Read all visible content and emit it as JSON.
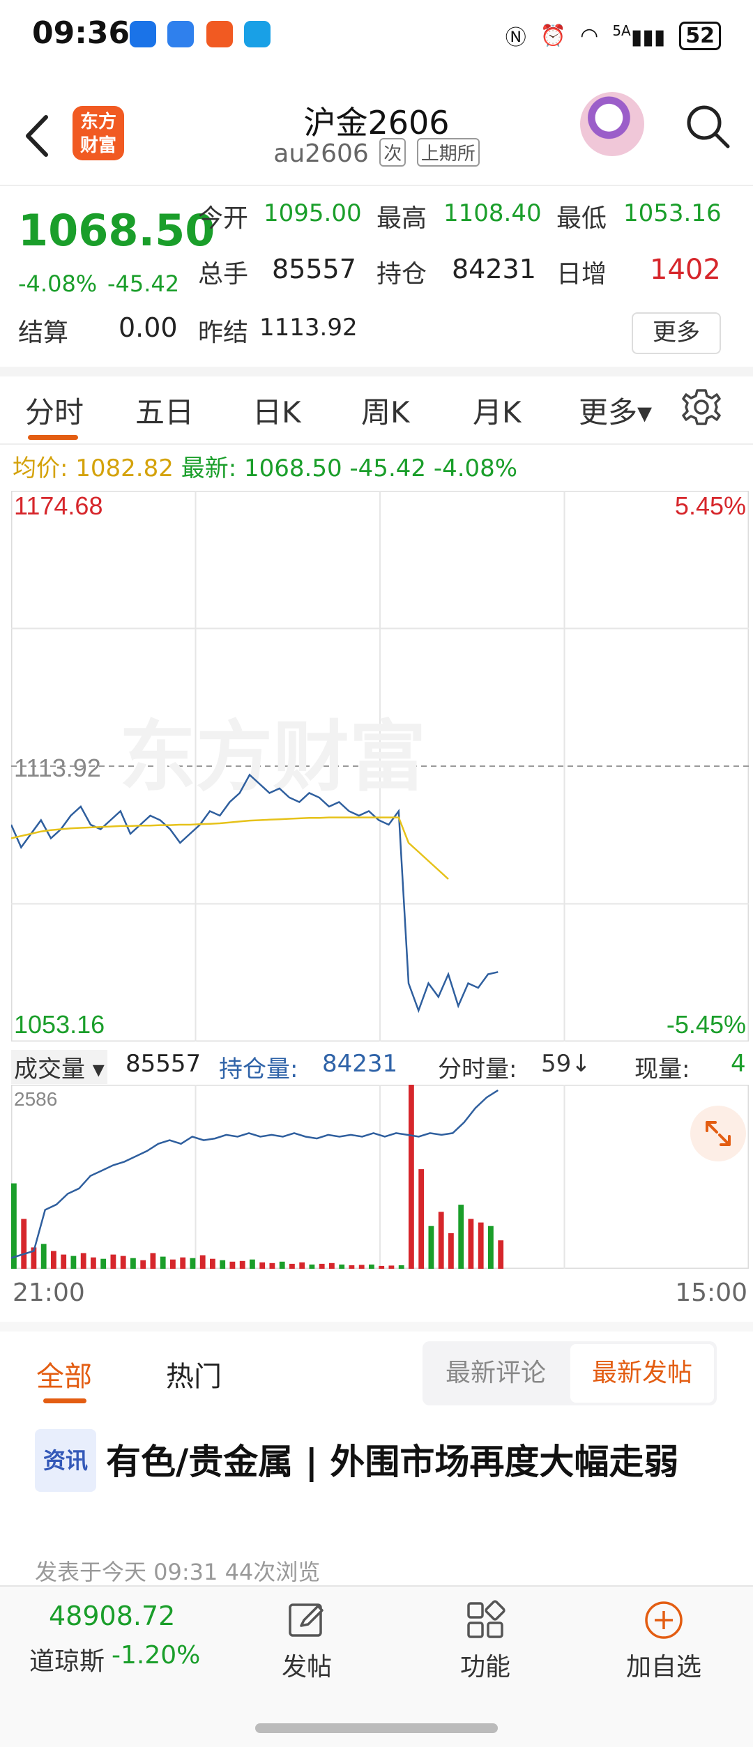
{
  "status_bar": {
    "time": "09:36",
    "network": "5A",
    "battery": "52"
  },
  "header": {
    "logo_text": "东方财富",
    "title": "沪金2606",
    "code": "au2606",
    "tag1": "次",
    "tag2": "上期所"
  },
  "quote": {
    "price": "1068.50",
    "change_pct": "-4.08%",
    "change_amt": "-45.42",
    "open_label": "今开",
    "open_value": "1095.00",
    "high_label": "最高",
    "high_value": "1108.40",
    "low_label": "最低",
    "low_value": "1053.16",
    "volume_label": "总手",
    "volume_value": "85557",
    "position_label": "持仓",
    "position_value": "84231",
    "daily_inc_label": "日增",
    "daily_inc_value": "1402",
    "settle_label": "结算",
    "settle_value": "0.00",
    "prev_settle_label": "昨结",
    "prev_settle_value": "1113.92",
    "more_label": "更多"
  },
  "tabs": {
    "intraday": "分时",
    "five_day": "五日",
    "daily_k": "日K",
    "weekly_k": "周K",
    "monthly_k": "月K",
    "more": "更多▾"
  },
  "info_line": {
    "avg_label": "均价:",
    "avg_value": "1082.82",
    "latest_label": "最新:",
    "latest_value": "1068.50",
    "latest_chg": "-45.42",
    "latest_pct": "-4.08%"
  },
  "chart_data": {
    "type": "line",
    "title": "",
    "y_max_label": "1174.68",
    "y_mid_label": "1113.92",
    "y_min_label": "1053.16",
    "pct_max_label": "5.45%",
    "pct_min_label": "-5.45%",
    "ylim": [
      1053.16,
      1174.68
    ],
    "prev_settle": 1113.92,
    "x_start_label": "21:00",
    "x_end_label": "15:00",
    "watermark": "东方财富",
    "session_fraction_elapsed": 0.66,
    "series": [
      {
        "name": "price",
        "values": [
          1101,
          1096,
          1099,
          1102,
          1098,
          1100,
          1103,
          1105,
          1101,
          1100,
          1102,
          1104,
          1099,
          1101,
          1103,
          1102,
          1100,
          1097,
          1099,
          1101,
          1104,
          1103,
          1106,
          1108,
          1112,
          1110,
          1108,
          1109,
          1107,
          1106,
          1108,
          1107,
          1105,
          1106,
          1104,
          1103,
          1104,
          1102,
          1101,
          1104,
          1066,
          1060,
          1066,
          1063,
          1068,
          1061,
          1066,
          1065,
          1068,
          1068.5
        ]
      },
      {
        "name": "avg",
        "values": [
          1098,
          1098.5,
          1099,
          1099.5,
          1099.8,
          1100,
          1100.2,
          1100.3,
          1100.4,
          1100.5,
          1100.6,
          1100.7,
          1100.7,
          1100.8,
          1100.8,
          1100.9,
          1100.9,
          1101,
          1101,
          1101.1,
          1101.2,
          1101.3,
          1101.5,
          1101.7,
          1101.9,
          1102,
          1102.1,
          1102.2,
          1102.3,
          1102.4,
          1102.5,
          1102.5,
          1102.6,
          1102.6,
          1102.6,
          1102.6,
          1102.6,
          1102.6,
          1102.6,
          1102.6,
          1097,
          1095,
          1093,
          1091,
          1089
        ]
      }
    ],
    "volume": {
      "label": "成交量",
      "total_label": "85557",
      "position_label": "持仓量:",
      "position_value": "84231",
      "tick_label": "分时量:",
      "tick_value": "59↓",
      "current_label": "现量:",
      "current_value": "4",
      "y_max_label": "2586",
      "bars": [
        1200,
        700,
        300,
        350,
        250,
        200,
        180,
        220,
        160,
        140,
        200,
        180,
        150,
        120,
        220,
        170,
        130,
        160,
        150,
        190,
        140,
        120,
        100,
        110,
        130,
        90,
        80,
        100,
        70,
        90,
        60,
        70,
        80,
        60,
        50,
        55,
        60,
        40,
        45,
        50,
        2586,
        1400,
        600,
        800,
        500,
        900,
        700,
        650,
        600,
        400
      ],
      "position_line": [
        0.06,
        0.08,
        0.1,
        0.33,
        0.36,
        0.42,
        0.45,
        0.52,
        0.55,
        0.58,
        0.6,
        0.63,
        0.66,
        0.7,
        0.72,
        0.7,
        0.74,
        0.72,
        0.73,
        0.75,
        0.74,
        0.76,
        0.74,
        0.75,
        0.74,
        0.76,
        0.74,
        0.73,
        0.75,
        0.74,
        0.75,
        0.74,
        0.76,
        0.74,
        0.76,
        0.75,
        0.74,
        0.76,
        0.75,
        0.76,
        0.82,
        0.9,
        0.96,
        1.0
      ]
    }
  },
  "news": {
    "tab_all": "全部",
    "tab_hot": "热门",
    "seg_comment": "最新评论",
    "seg_post": "最新发帖",
    "article_tag": "资讯",
    "article_title": "有色/贵金属 | 外围市场再度大幅走弱",
    "article_meta": "发表于今天 09:31    44次浏览"
  },
  "bottom": {
    "dji_value": "48908.72",
    "dji_name": "道琼斯",
    "dji_pct": "-1.20%",
    "post": "发帖",
    "functions": "功能",
    "add_watch": "加自选"
  },
  "colors": {
    "up": "#d6262b",
    "down": "#1a9e2a",
    "accent": "#e35d12",
    "price_line": "#2f5f9e",
    "avg_line": "#e6c21a"
  }
}
